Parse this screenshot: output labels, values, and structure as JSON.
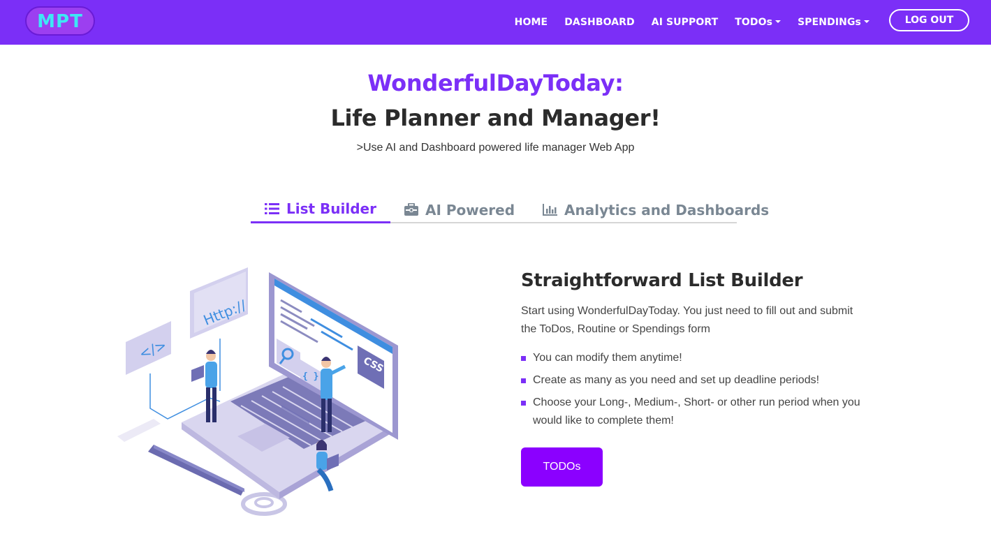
{
  "brand": {
    "logo_text": "MPT"
  },
  "nav": {
    "items": [
      {
        "label": "HOME",
        "dropdown": false
      },
      {
        "label": "DASHBOARD",
        "dropdown": false
      },
      {
        "label": "AI SUPPORT",
        "dropdown": false
      },
      {
        "label": "TODOs",
        "dropdown": true
      },
      {
        "label": "SPENDINGs",
        "dropdown": true
      }
    ],
    "logout_label": "LOG OUT"
  },
  "hero": {
    "title": "WonderfulDayToday:",
    "subtitle": "Life Planner and Manager!",
    "tagline": ">Use AI and Dashboard powered life manager Web App"
  },
  "tabs": [
    {
      "label": "List Builder",
      "icon": "list-icon",
      "active": true
    },
    {
      "label": "AI Powered",
      "icon": "toolbox-icon",
      "active": false
    },
    {
      "label": "Analytics and Dashboards",
      "icon": "bar-chart-icon",
      "active": false
    }
  ],
  "illustration": {
    "http_label": "Http://",
    "code_label": "</>",
    "braces_label": "{ }",
    "css_label": "CSS"
  },
  "feature": {
    "title": "Straightforward List Builder",
    "description": "Start using WonderfulDayToday. You just need to fill out and submit the ToDos, Routine or Spendings form",
    "bullets": [
      "You can modify them anytime!",
      "Create as many as you need and set up deadline periods!",
      "Choose your Long-, Medium-, Short- or other run period when you would like to complete them!"
    ],
    "button_label": "TODOs"
  },
  "colors": {
    "brand": "#7b2ff7",
    "button": "#8b00ff",
    "tab_inactive": "#7a8793"
  }
}
